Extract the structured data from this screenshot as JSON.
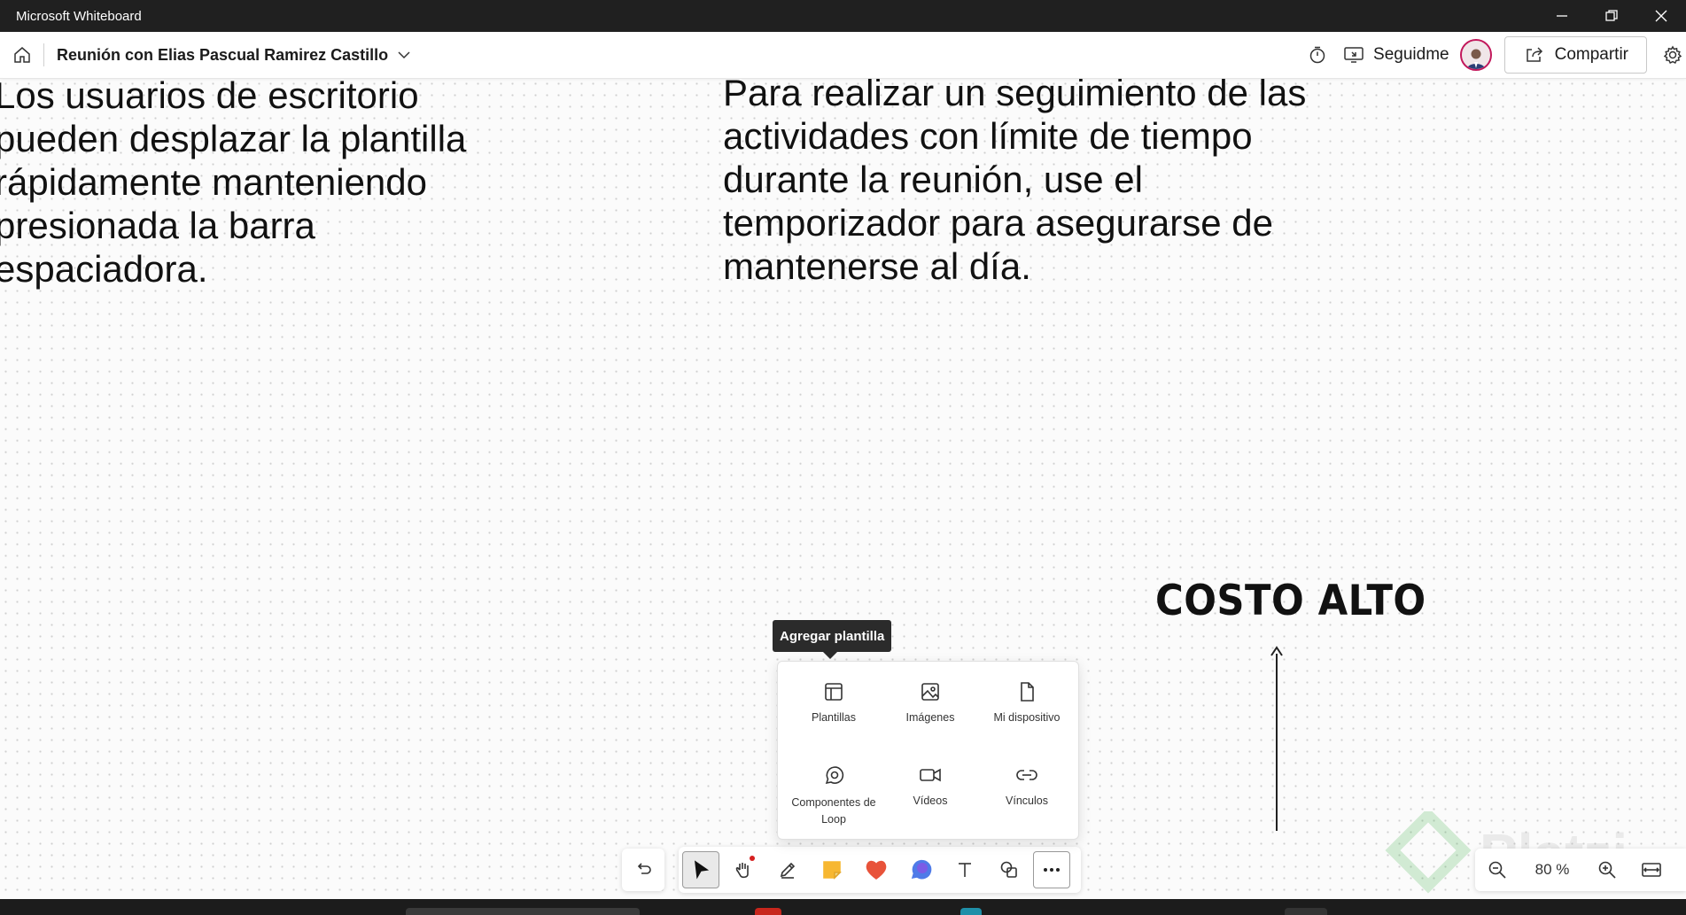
{
  "window": {
    "title": "Microsoft Whiteboard"
  },
  "appbar": {
    "board_title": "Reunión con Elias Pascual Ramirez Castillo",
    "follow_label": "Seguidme",
    "share_label": "Compartir"
  },
  "canvas": {
    "note_left": "Los usuarios de escritorio pueden desplazar la plantilla rápidamente manteniendo presionada la barra espaciadora.",
    "note_right": "Para realizar un seguimiento de las actividades con límite de tiempo durante la reunión, use el temporizador para asegurarse de mantenerse al día.",
    "label_costo": "COSTO ALTO",
    "watermark": "Platzi"
  },
  "tooltip": {
    "text": "Agregar plantilla"
  },
  "insert_menu": {
    "items": [
      {
        "label": "Plantillas",
        "icon": "template-icon"
      },
      {
        "label": "Imágenes",
        "icon": "image-icon"
      },
      {
        "label": "Mi dispositivo",
        "icon": "file-icon"
      },
      {
        "label": "Componentes de Loop",
        "icon": "loop-icon"
      },
      {
        "label": "Vídeos",
        "icon": "video-icon"
      },
      {
        "label": "Vínculos",
        "icon": "link-icon"
      }
    ]
  },
  "toolbar": {
    "tools": [
      "undo-icon",
      "select-icon",
      "hand-icon",
      "pen-icon",
      "sticky-note-icon",
      "heart-icon",
      "chat-bubble-icon",
      "text-icon",
      "shapes-icon",
      "more-icon"
    ],
    "zoom_label": "80 %"
  },
  "colors": {
    "titlebar": "#202020",
    "sticky": "#f7b731",
    "heart": "#e8533a",
    "bubble": "#4f7be8",
    "avatar_ring": "#c2185b"
  }
}
